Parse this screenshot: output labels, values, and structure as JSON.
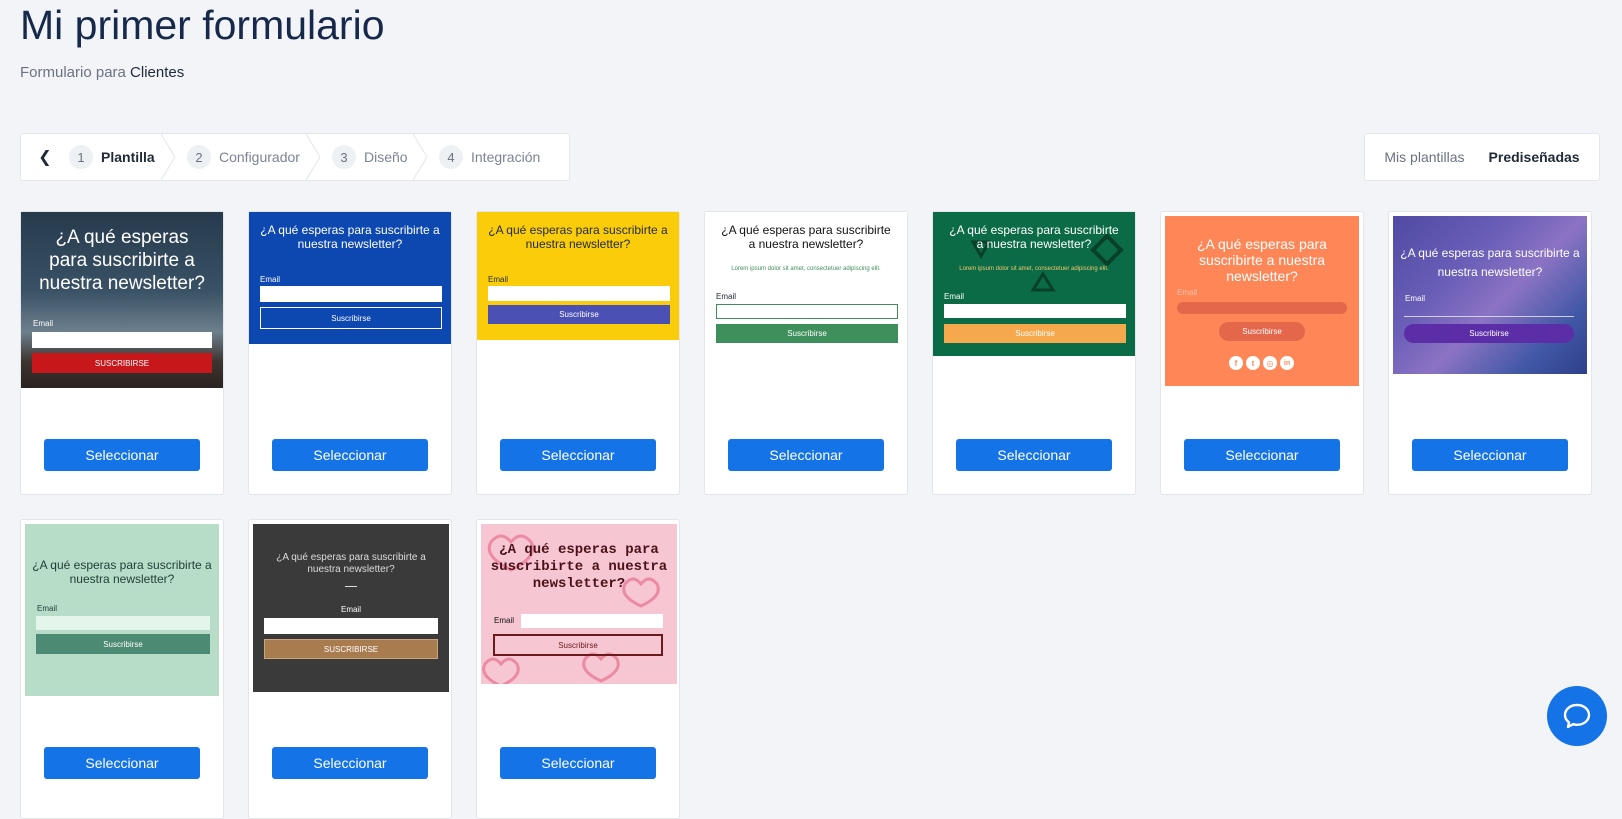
{
  "header": {
    "title": "Mi primer formulario",
    "subtitle_prefix": "Formulario para",
    "subtitle_value": "Clientes"
  },
  "stepper": {
    "steps": [
      {
        "num": "1",
        "label": "Plantilla",
        "active": true
      },
      {
        "num": "2",
        "label": "Configurador"
      },
      {
        "num": "3",
        "label": "Diseño"
      },
      {
        "num": "4",
        "label": "Integración"
      }
    ]
  },
  "template_tabs": {
    "mine": "Mis plantillas",
    "predesigned": "Prediseñadas",
    "active": "predesigned"
  },
  "select_label": "Seleccionar",
  "templates": [
    {
      "heading": "¿A qué esperas para suscribirte a nuestra newsletter?",
      "email_label": "Email",
      "button": "SUSCRIBIRSE",
      "accent": "#c8171b"
    },
    {
      "heading": "¿A qué esperas para suscribirte a nuestra newsletter?",
      "email_label": "Email",
      "button": "Suscribirse",
      "accent": "#0d47a1"
    },
    {
      "heading": "¿A qué esperas para suscribirte a nuestra newsletter?",
      "email_label": "Email",
      "button": "Suscribirse",
      "accent": "#4b50b3"
    },
    {
      "heading": "¿A qué esperas para suscribirte a nuestra newsletter?",
      "lorem": "Lorem ipsum dolor sit amet, consectetuer adipiscing elit.",
      "email_label": "Email",
      "button": "Suscribirse",
      "accent": "#3f8f5c"
    },
    {
      "heading": "¿A qué esperas para suscribirte a nuestra newsletter?",
      "lorem": "Lorem ipsum dolor sit amet, consectetuer adipiscing elit.",
      "email_label": "Email",
      "button": "Suscribirse",
      "accent": "#f5a94c"
    },
    {
      "heading": "¿A qué esperas para suscribirte a nuestra newsletter?",
      "email_label": "Email",
      "button": "Suscribirse",
      "accent": "#e5674b",
      "social": [
        "f",
        "t",
        "◎",
        "in"
      ]
    },
    {
      "heading": "¿A qué esperas para suscribirte a nuestra newsletter?",
      "email_label": "Email",
      "button": "Suscribirse",
      "accent": "#5b2da6"
    },
    {
      "heading": "¿A qué esperas para suscribirte a nuestra newsletter?",
      "email_label": "Email",
      "button": "Suscribirse",
      "accent": "#4d8a73"
    },
    {
      "heading": "¿A qué esperas para suscribirte a nuestra newsletter?",
      "email_label": "Email",
      "button": "SUSCRIBIRSE",
      "accent": "#a87c4f"
    },
    {
      "heading": "¿A qué esperas para suscribirte a nuestra newsletter?",
      "email_label": "Email",
      "button": "Suscribirse",
      "accent": "#6b1b1b"
    }
  ]
}
